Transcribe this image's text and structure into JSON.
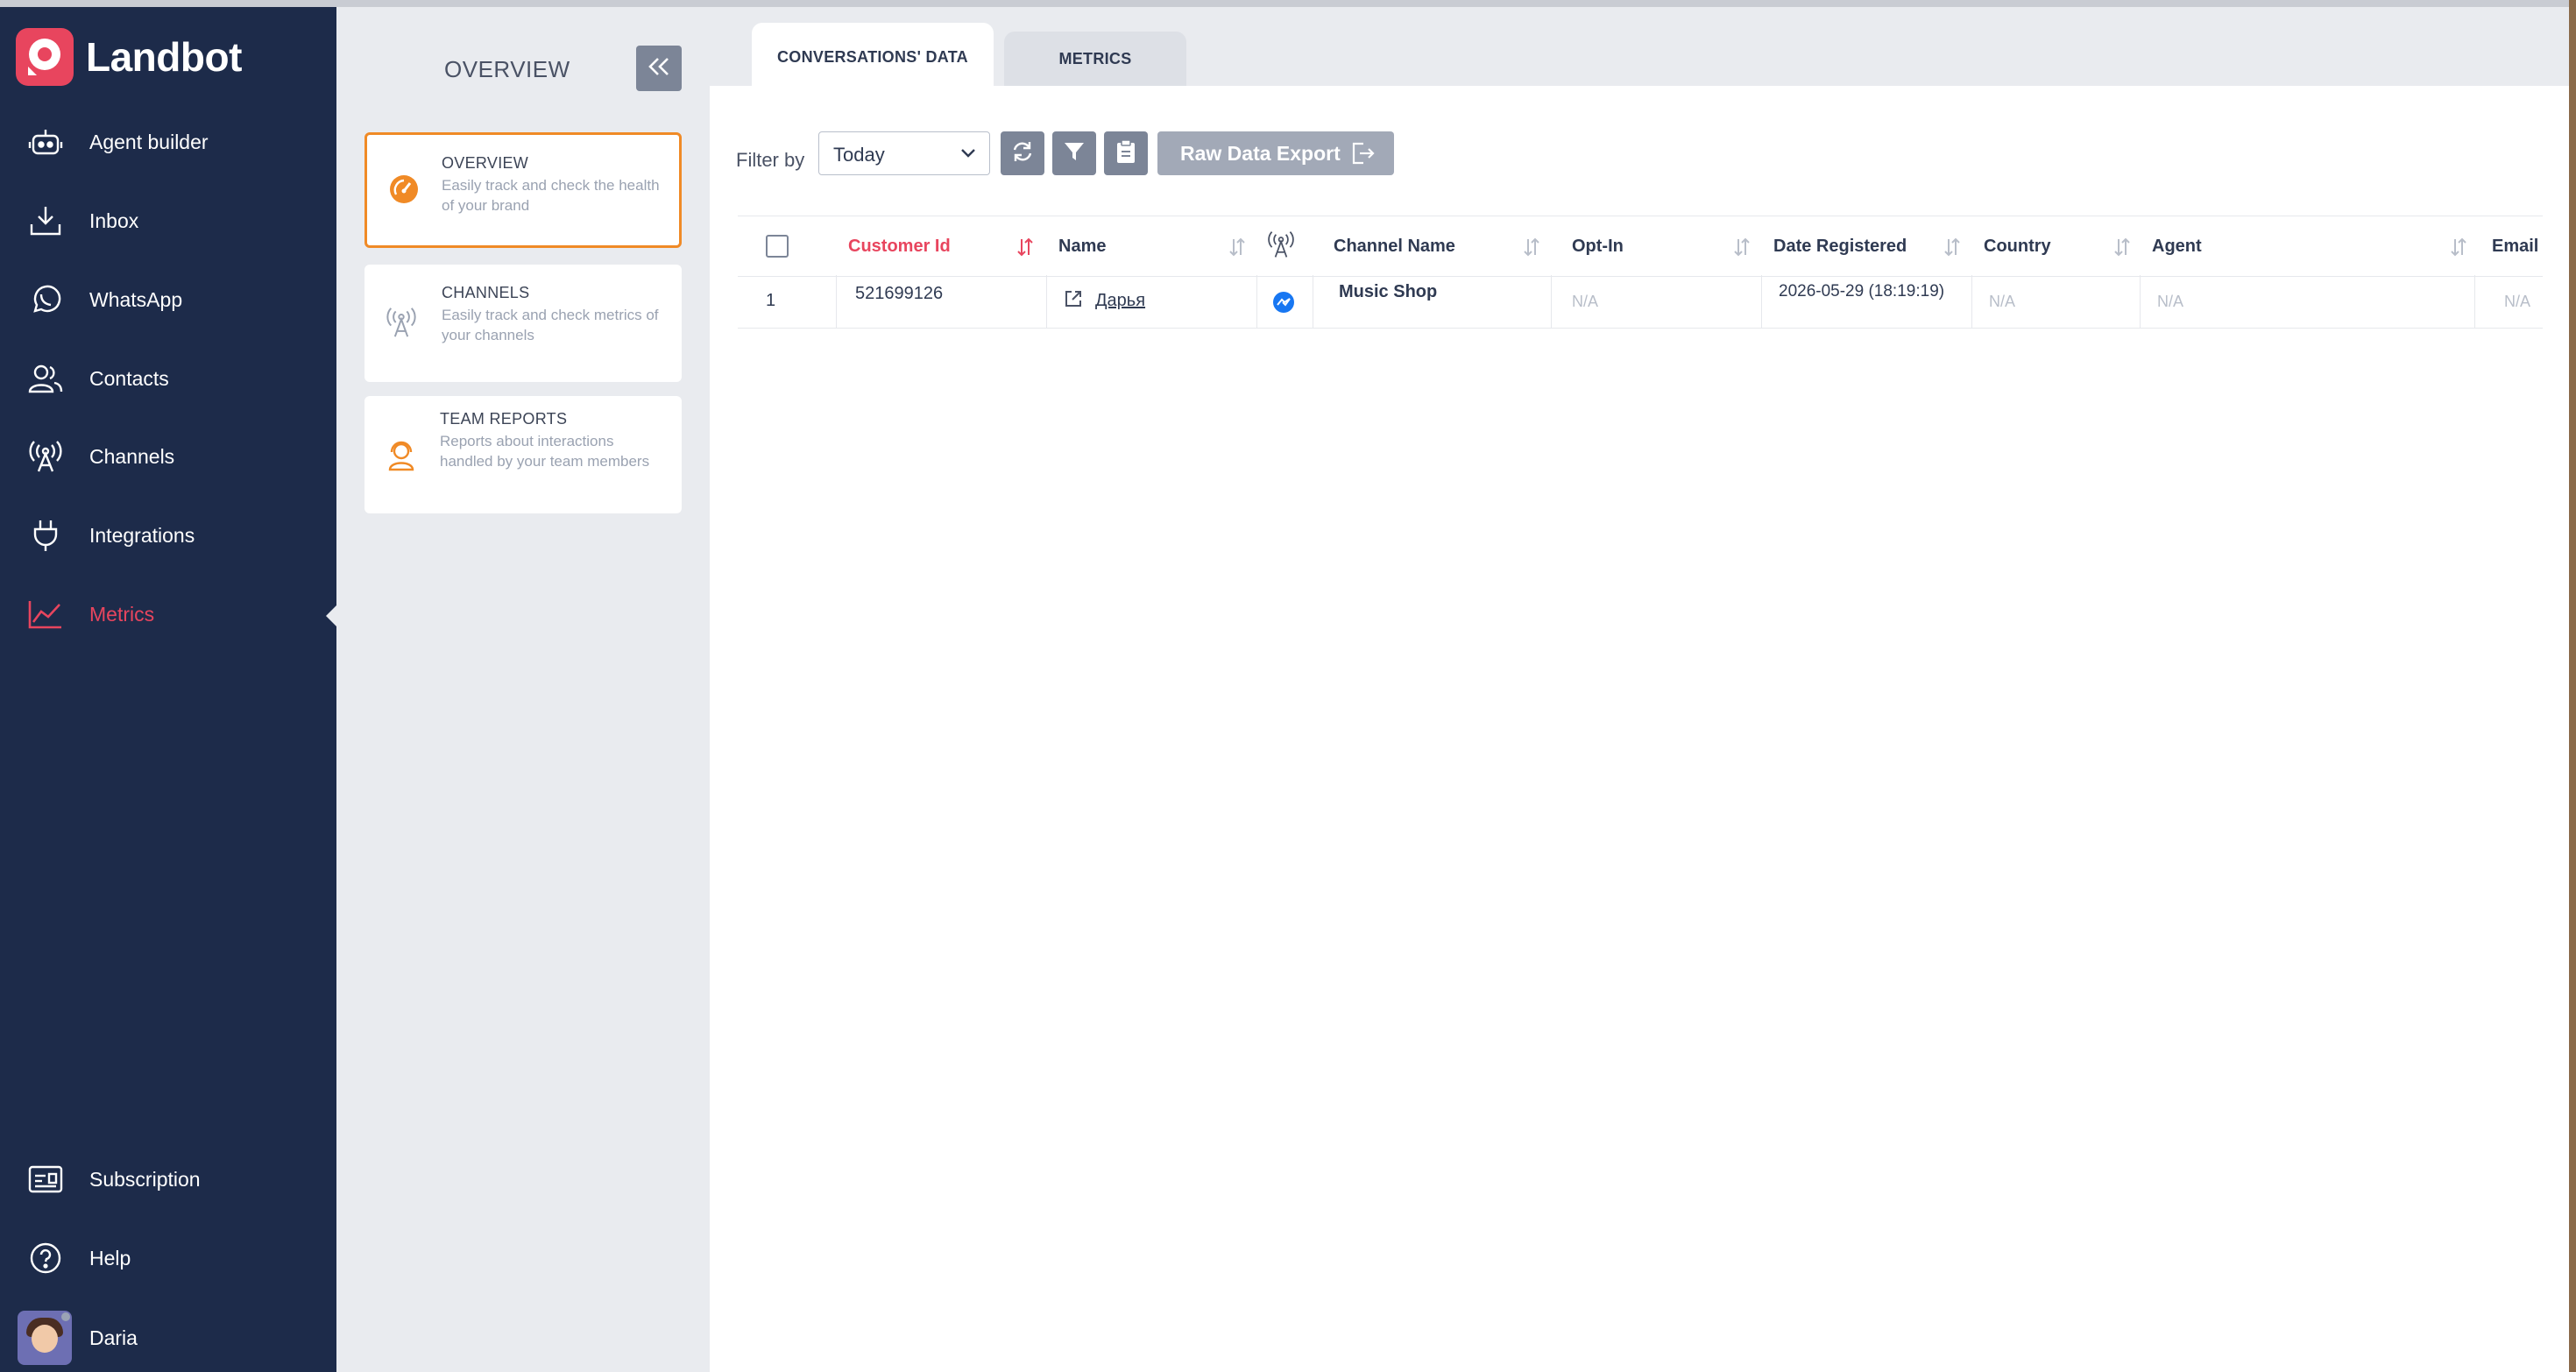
{
  "app": {
    "name": "Landbot"
  },
  "nav": {
    "items": [
      {
        "label": "Agent builder",
        "icon": "robot-icon"
      },
      {
        "label": "Inbox",
        "icon": "inbox-download-icon"
      },
      {
        "label": "WhatsApp",
        "icon": "whatsapp-icon"
      },
      {
        "label": "Contacts",
        "icon": "contacts-icon"
      },
      {
        "label": "Channels",
        "icon": "antenna-icon"
      },
      {
        "label": "Integrations",
        "icon": "plug-icon"
      },
      {
        "label": "Metrics",
        "icon": "chart-line-icon",
        "active": true
      }
    ],
    "bottom": [
      {
        "label": "Subscription",
        "icon": "subscription-icon"
      },
      {
        "label": "Help",
        "icon": "help-icon"
      }
    ],
    "user": {
      "name": "Daria"
    }
  },
  "panel": {
    "title": "OVERVIEW",
    "cards": [
      {
        "title": "OVERVIEW",
        "description": "Easily track and check the health of your brand",
        "icon": "gauge-icon",
        "active": true
      },
      {
        "title": "CHANNELS",
        "description": "Easily track and check metrics of your channels",
        "icon": "antenna-icon"
      },
      {
        "title": "TEAM REPORTS",
        "description": "Reports about interactions handled by your team members",
        "icon": "agent-headset-icon"
      }
    ]
  },
  "tabs": [
    {
      "label": "CONVERSATIONS' DATA",
      "active": true
    },
    {
      "label": "METRICS"
    }
  ],
  "filter": {
    "label": "Filter by",
    "selected": "Today",
    "export_label": "Raw Data Export"
  },
  "table": {
    "columns": [
      "Customer Id",
      "Name",
      "Channel Name",
      "Opt-In",
      "Date Registered",
      "Country",
      "Agent",
      "Email"
    ],
    "sorted_column": "Customer Id",
    "rows": [
      {
        "index": "1",
        "customer_id": "521699126",
        "name": "Дарья",
        "channel_icon": "messenger-icon",
        "channel_name": "Music Shop",
        "opt_in": "N/A",
        "date_registered": "2026-05-29 (18:19:19)",
        "country": "N/A",
        "agent": "N/A",
        "email": "N/A"
      }
    ]
  },
  "colors": {
    "sidebar": "#1d2b4a",
    "accent": "#e8455e",
    "card_active_border": "#f08a26",
    "button_gray": "#7c8597",
    "messenger": "#1877f2"
  }
}
